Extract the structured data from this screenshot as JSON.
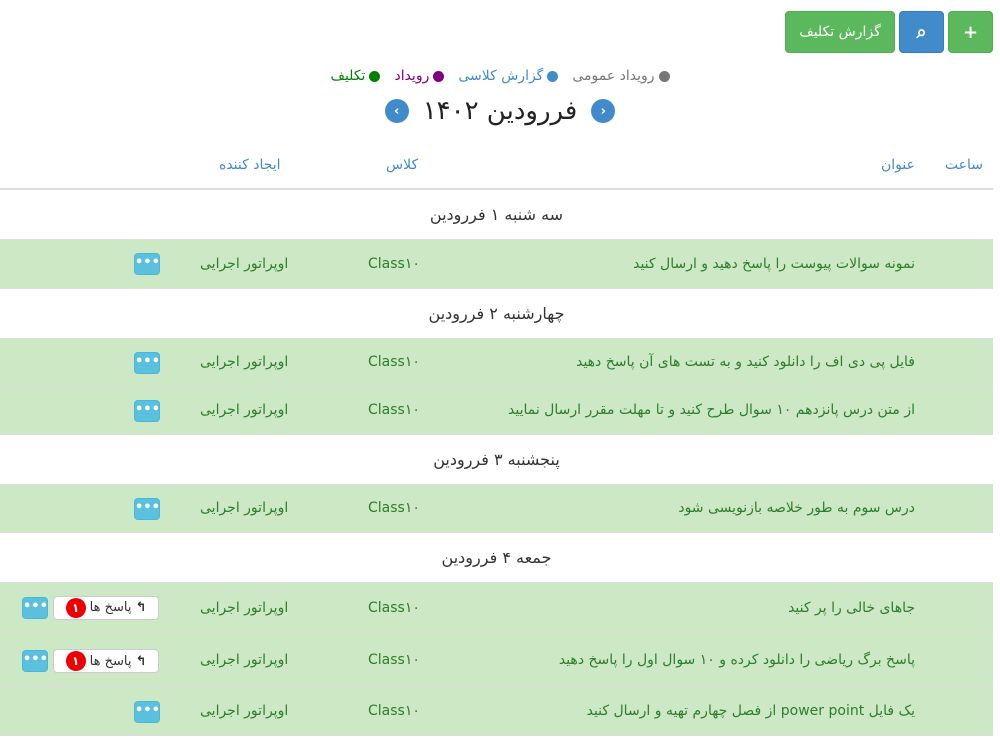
{
  "toolbar": {
    "add_label": "+",
    "search_label": "⌕",
    "report_label": "گزارش تکلیف"
  },
  "legend": [
    {
      "label": "تکلیف",
      "color": "#008000"
    },
    {
      "label": "رویداد",
      "color": "#800080"
    },
    {
      "label": "گزارش کلاسی",
      "color": "#428bca"
    },
    {
      "label": "رویداد عمومی",
      "color": "#777777"
    }
  ],
  "month": {
    "title": "فررودین ۱۴۰۲",
    "prev_icon": "‹",
    "next_icon": "›"
  },
  "columns": {
    "time": "ساعت",
    "title": "عنوان",
    "class": "کلاس",
    "creator": "ایجاد کننده"
  },
  "days": [
    {
      "label": "سه شنبه ۱ فررودین",
      "events": [
        {
          "title": "نمونه سوالات پیوست را پاسخ دهید و ارسال کنید",
          "class": "Class۱۰",
          "creator": "اوپراتور اجرایی",
          "more": "•••"
        }
      ]
    },
    {
      "label": "چهارشنبه ۲ فررودین",
      "events": [
        {
          "title": "فایل پی دی اف را دانلود کنید و به تست های آن پاسخ دهید",
          "class": "Class۱۰",
          "creator": "اوپراتور اجرایی",
          "more": "•••"
        },
        {
          "title": "از متن درس پانزدهم ۱۰ سوال طرح کنید و تا مهلت مقرر ارسال نمایید",
          "class": "Class۱۰",
          "creator": "اوپراتور اجرایی",
          "more": "•••"
        }
      ]
    },
    {
      "label": "پنجشنبه ۳ فررودین",
      "events": [
        {
          "title": "درس سوم به طور خلاصه بازنویسی شود",
          "class": "Class۱۰",
          "creator": "اوپراتور اجرایی",
          "more": "•••"
        }
      ]
    },
    {
      "label": "جمعه ۴ فررودین",
      "events": [
        {
          "title": "جاهای خالی را پر کنید",
          "class": "Class۱۰",
          "creator": "اوپراتور اجرایی",
          "more": "•••",
          "reply": {
            "label": "پاسخ ها",
            "count": "۱",
            "icon": "↰"
          }
        },
        {
          "title": "پاسخ برگ ریاضی را دانلود کرده و ۱۰ سوال اول را پاسخ دهید",
          "class": "Class۱۰",
          "creator": "اوپراتور اجرایی",
          "more": "•••",
          "reply": {
            "label": "پاسخ ها",
            "count": "۱",
            "icon": "↰"
          }
        },
        {
          "title": "یک فایل power point از فصل چهارم تهیه و ارسال کنید",
          "class": "Class۱۰",
          "creator": "اوپراتور اجرایی",
          "more": "•••"
        }
      ]
    }
  ]
}
